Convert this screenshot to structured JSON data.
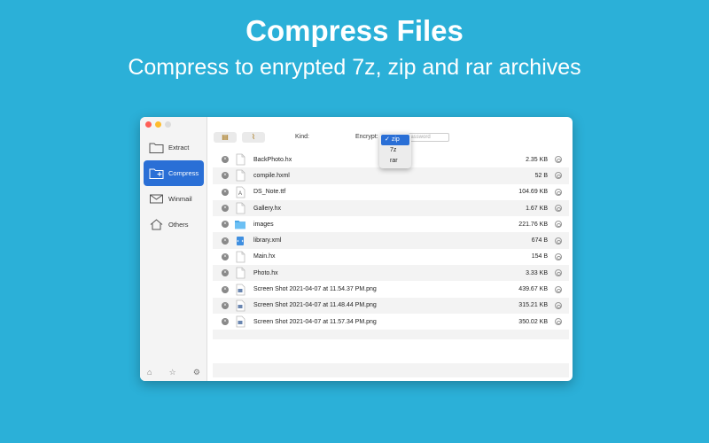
{
  "hero": {
    "title": "Compress Files",
    "subtitle": "Compress to enrypted 7z, zip and rar archives"
  },
  "colors": {
    "background": "#2bb0d8",
    "accent": "#2a6fd6",
    "close": "#fe5f57",
    "minimize": "#febc2e",
    "zoom": "#dcdcdc"
  },
  "sidebar": {
    "items": [
      {
        "label": "Extract",
        "icon": "folder-icon",
        "active": false
      },
      {
        "label": "Compress",
        "icon": "folder-plus-icon",
        "active": true
      },
      {
        "label": "Winmail",
        "icon": "envelope-icon",
        "active": false
      },
      {
        "label": "Others",
        "icon": "house-icon",
        "active": false
      }
    ],
    "bottom_icons": [
      "home-icon",
      "star-icon",
      "gear-icon"
    ]
  },
  "toolbar": {
    "kind_label": "Kind:",
    "encrypt_label": "Encrypt:",
    "password_placeholder": "Enter password"
  },
  "kind_dropdown": {
    "options": [
      "zip",
      "7z",
      "rar"
    ],
    "selected": "zip"
  },
  "files": [
    {
      "name": "BackPhoto.hx",
      "size": "2.35 KB",
      "icon": "file-icon"
    },
    {
      "name": "compile.hxml",
      "size": "52 B",
      "icon": "file-icon"
    },
    {
      "name": "DS_Note.ttf",
      "size": "104.69 KB",
      "icon": "font-file-icon"
    },
    {
      "name": "Gallery.hx",
      "size": "1.67 KB",
      "icon": "file-icon"
    },
    {
      "name": "images",
      "size": "221.76 KB",
      "icon": "folder-icon"
    },
    {
      "name": "library.xml",
      "size": "674 B",
      "icon": "xml-file-icon"
    },
    {
      "name": "Main.hx",
      "size": "154 B",
      "icon": "file-icon"
    },
    {
      "name": "Photo.hx",
      "size": "3.33 KB",
      "icon": "file-icon"
    },
    {
      "name": "Screen Shot 2021-04-07 at 11.54.37 PM.png",
      "size": "439.67 KB",
      "icon": "image-file-icon"
    },
    {
      "name": "Screen Shot 2021-04-07 at 11.48.44 PM.png",
      "size": "315.21 KB",
      "icon": "image-file-icon"
    },
    {
      "name": "Screen Shot 2021-04-07 at 11.57.34 PM.png",
      "size": "350.02 KB",
      "icon": "image-file-icon"
    }
  ]
}
